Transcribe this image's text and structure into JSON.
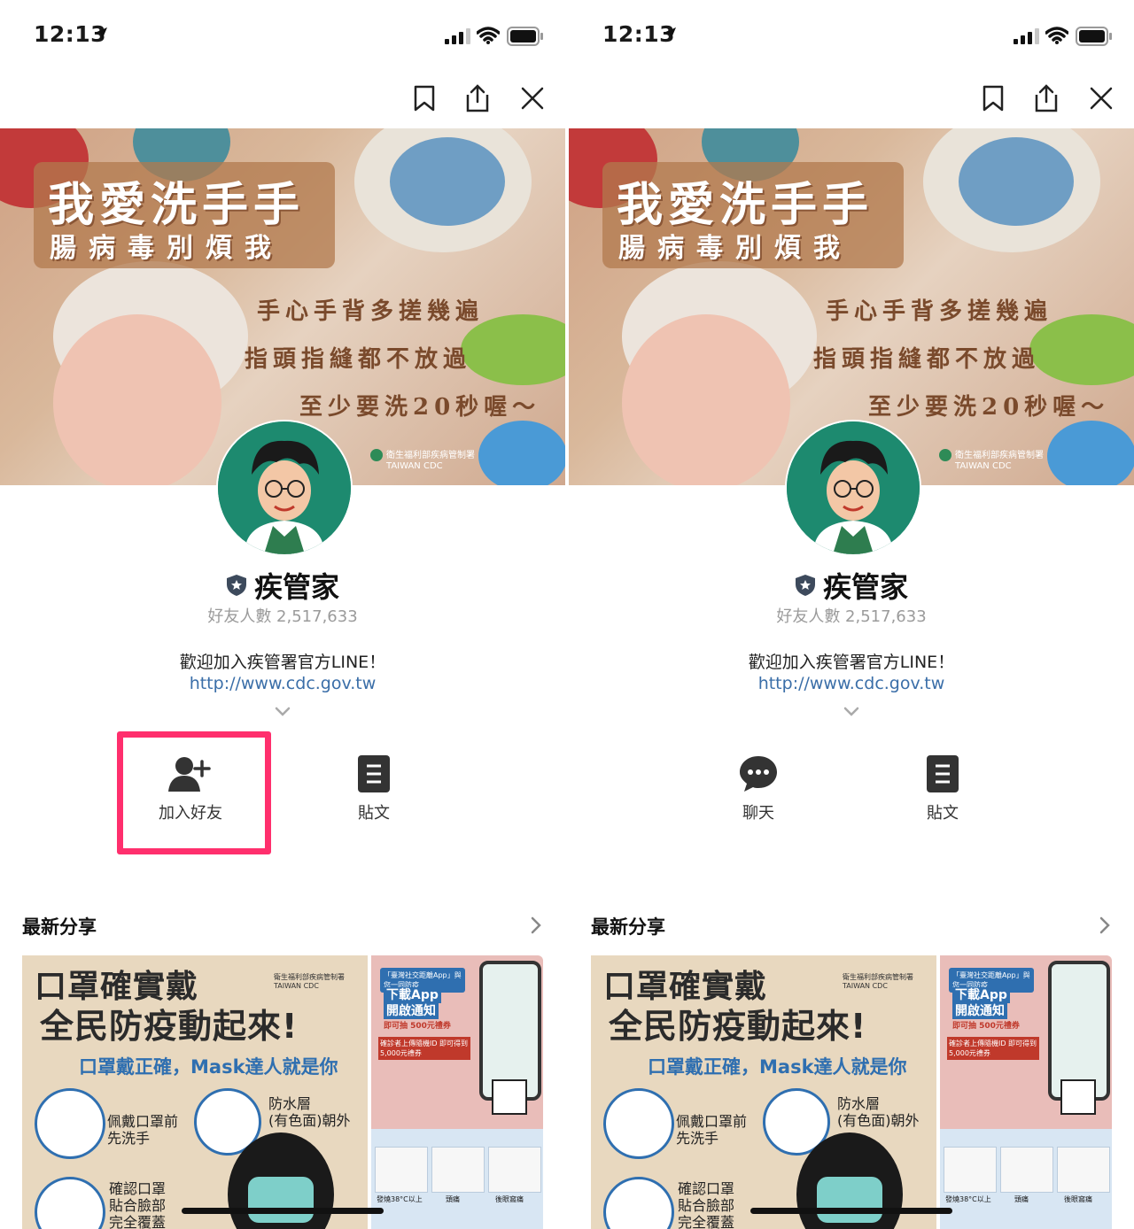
{
  "status_bar": {
    "time": "12:13"
  },
  "profile": {
    "name": "疾管家",
    "friends_count": "好友人數 2,517,633",
    "welcome": "歡迎加入疾管署官方LINE！",
    "link": "http://www.cdc.gov.tw"
  },
  "cover": {
    "title": "我愛洗手手",
    "subtitle": "腸病毒別煩我",
    "line1": "手心手背多搓幾遍",
    "line2": "指頭指縫都不放過",
    "line3": "至少要洗20秒喔～",
    "logo_text": "衛生福利部疾病管制署",
    "logo_en": "TAIWAN CDC"
  },
  "panels": [
    {
      "actions": [
        {
          "label": "加入好友",
          "icon": "add-friend-icon"
        },
        {
          "label": "貼文",
          "icon": "post-icon"
        }
      ]
    },
    {
      "actions": [
        {
          "label": "聊天",
          "icon": "chat-icon"
        },
        {
          "label": "貼文",
          "icon": "post-icon"
        }
      ]
    }
  ],
  "latest": {
    "title": "最新分享",
    "poster": {
      "headline1": "口罩確實戴",
      "headline2": "全民防疫動起來!",
      "tagline": "口罩戴正確，Mask達人就是你",
      "logo_text": "衛生福利部疾病管制署",
      "logo_en": "TAIWAN CDC",
      "step1": "佩戴口罩前\n先洗手",
      "step2": "防水層\n(有色面)朝外",
      "step3": "確認口罩\n貼合臉部\n完全覆蓋"
    },
    "poster2": {
      "banner": "「臺灣社交距離App」與您一同防疫",
      "big1": "下載App",
      "big2": "開啟通知",
      "prize": "即可抽 500元禮券",
      "note": "確診者上傳隨機ID 即可得到5,000元禮券",
      "grid_labels": [
        "發燒38°C以上",
        "頭痛",
        "後眼窩痛"
      ]
    }
  },
  "colors": {
    "highlight": "#ff2f6d",
    "link": "#3a6ea8",
    "avatar_bg": "#1d8a6f"
  }
}
